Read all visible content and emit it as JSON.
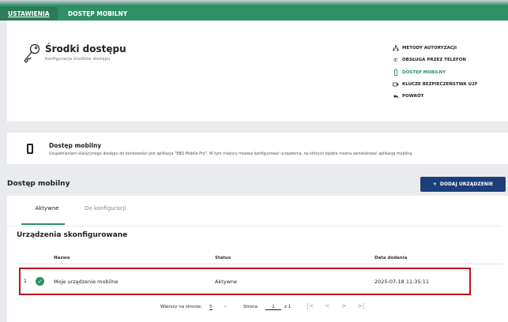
{
  "topbar": {
    "tab1": "USTAWIENIA",
    "tab2": "DOSTĘP MOBILNY"
  },
  "header": {
    "title": "Środki dostępu",
    "subtitle": "Konfiguracja środków dostępu"
  },
  "side_menu": [
    {
      "label": "METODY AUTORYZACJI",
      "icon": "hierarchy-icon",
      "active": false
    },
    {
      "label": "OBSŁUGA PRZEZ TELEFON",
      "icon": "phone-handset-icon",
      "active": false
    },
    {
      "label": "DOSTĘP MOBILNY",
      "icon": "mobile-icon",
      "active": true
    },
    {
      "label": "KLUCZE BEZPIECZEŃSTWA U2F",
      "icon": "usb-key-icon",
      "active": false
    },
    {
      "label": "POWRÓT",
      "icon": "back-arrow-icon",
      "active": false
    }
  ],
  "info": {
    "title": "Dostęp mobilny",
    "description": "Uzupełnieniem klasycznego dostępu do bankowości jest aplikacja \"EBO Mobile Pro\". W tym miejscu możesz konfigurować urządzenia, na których będzie można zainstalować aplikację mobilną."
  },
  "section": {
    "title": "Dostęp mobilny",
    "add_button": "DODAJ URZĄDZENIE"
  },
  "tabs": {
    "active": "Aktywne",
    "inactive": "Do konfiguracji"
  },
  "devices": {
    "title": "Urządzenia skonfigurowane",
    "columns": [
      "Nazwa",
      "Status",
      "Data dodania"
    ],
    "rows": [
      {
        "index": "1",
        "name": "Moje urządzenie mobilne",
        "status": "Aktywne",
        "date": "2025-07-18 11:35:11"
      }
    ]
  },
  "pagination": {
    "rows_label": "Wierszy na stronie:",
    "rows_value": "5",
    "page_label": "Strona",
    "page_value": "1",
    "of_label": "z 1"
  },
  "colors": {
    "accent": "#2f8f66",
    "button": "#1c3f7a",
    "highlight": "#c0121c"
  }
}
